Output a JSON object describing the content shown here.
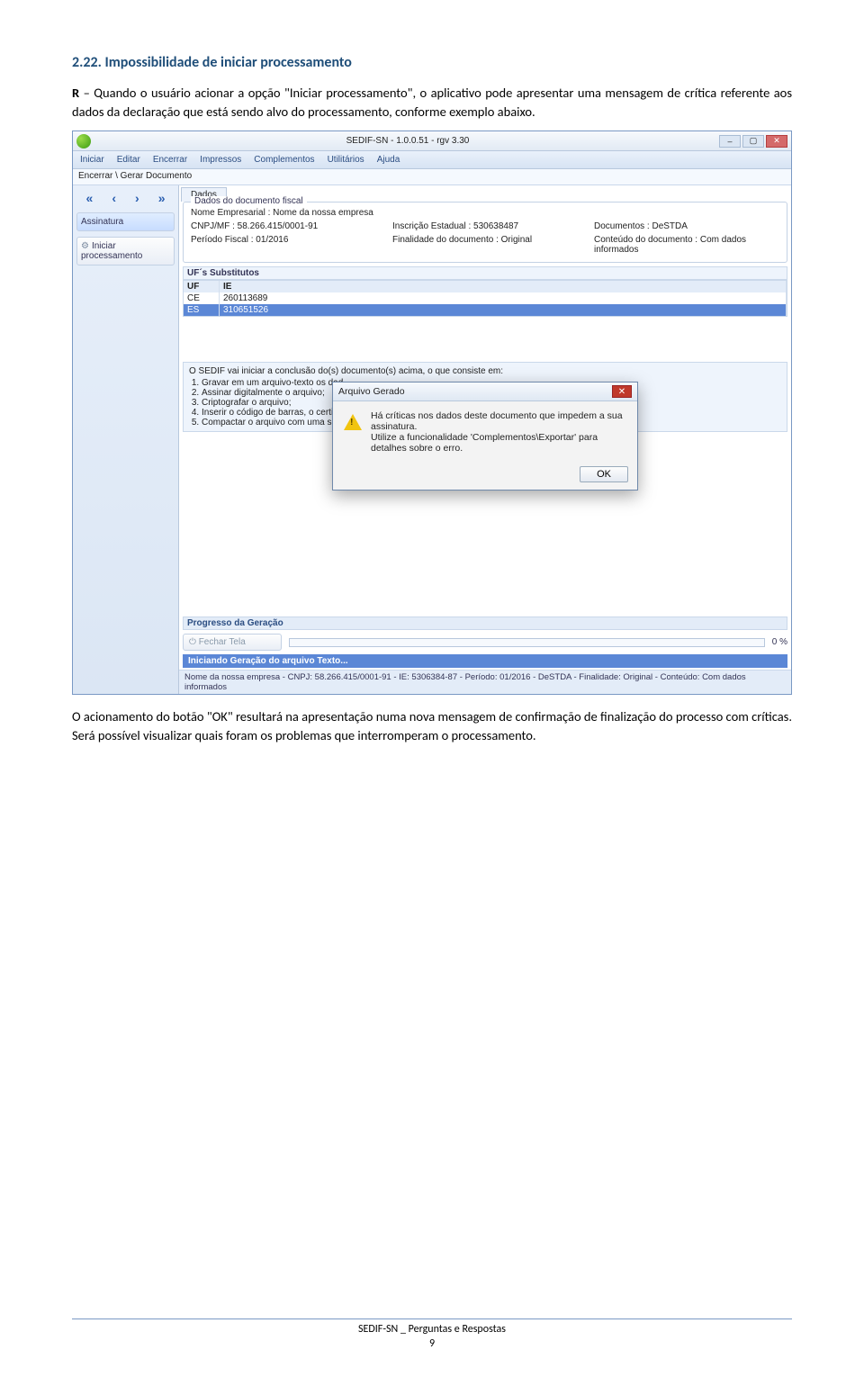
{
  "heading": "2.22.  Impossibilidade de iniciar processamento",
  "para1_prefix": "R",
  "para1_rest": " – Quando o usuário acionar a opção \"Iniciar processamento\", o aplicativo pode apresentar uma mensagem de crítica referente aos dados da declaração que está sendo alvo do processamento, conforme exemplo abaixo.",
  "para2": "O acionamento do botão \"OK\" resultará na apresentação numa nova mensagem de confirmação de finalização do processo com críticas. Será possível visualizar quais foram os problemas que interromperam o processamento.",
  "footer": {
    "line1": "SEDIF-SN _ Perguntas e Respostas",
    "page": "9"
  },
  "app": {
    "title": "SEDIF-SN - 1.0.0.51 - rgv 3.30",
    "menus": [
      "Iniciar",
      "Editar",
      "Encerrar",
      "Impressos",
      "Complementos",
      "Utilitários",
      "Ajuda"
    ],
    "crumb": "Encerrar \\ Gerar Documento",
    "nav": [
      "«",
      "‹",
      "›",
      "»"
    ],
    "side": {
      "assinatura": "Assinatura",
      "iniciar": "Iniciar processamento",
      "fechar": "Fechar Tela"
    },
    "tab": "Dados",
    "group_legend": "Dados do documento fiscal",
    "fields": {
      "nome_lbl": "Nome Empresarial : Nome da nossa empresa",
      "cnpj": "CNPJ/MF : 58.266.415/0001-91",
      "ie": "Inscrição Estadual : 530638487",
      "doc": "Documentos : DeSTDA",
      "periodo": "Período Fiscal : 01/2016",
      "finalidade": "Finalidade do documento : Original",
      "conteudo": "Conteúdo do documento : Com dados informados"
    },
    "subhead": "UF´s Substitutos",
    "th_uf": "UF",
    "th_ie": "IE",
    "rows": [
      {
        "uf": "CE",
        "ie": "260113689"
      },
      {
        "uf": "ES",
        "ie": "310651526"
      }
    ],
    "info_intro": "O SEDIF vai iniciar a conclusão do(s) documento(s) acima, o que consiste em:",
    "info_items": [
      "Gravar em um arquivo-texto os dad",
      "Assinar digitalmente o arquivo;",
      "Criptografar o arquivo;",
      "Inserir o código de barras, o certifi",
      "Compactar o arquivo com uma seg"
    ],
    "dialog": {
      "title": "Arquivo Gerado",
      "msg1": "Há críticas nos dados deste documento que impedem a sua assinatura.",
      "msg2": "Utilize a funcionalidade 'Complementos\\Exportar' para detalhes sobre o erro.",
      "ok": "OK"
    },
    "progress_label": "Progresso da Geração",
    "progress_pct": "0 %",
    "gen_line": "Iniciando Geração do arquivo Texto...",
    "status": "Nome da nossa empresa - CNPJ: 58.266.415/0001-91 - IE: 5306384-87 - Período: 01/2016 - DeSTDA - Finalidade: Original - Conteúdo: Com dados informados"
  }
}
